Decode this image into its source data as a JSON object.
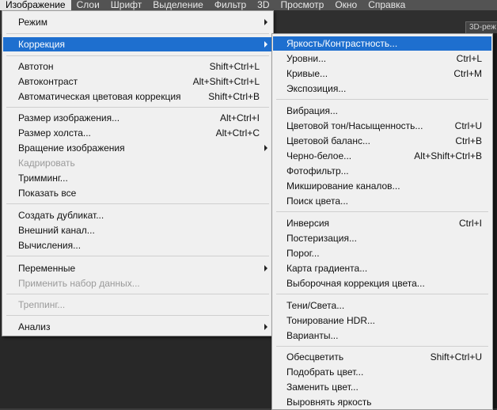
{
  "menubar": {
    "items": [
      {
        "label": "Изображение"
      },
      {
        "label": "Слои"
      },
      {
        "label": "Шрифт"
      },
      {
        "label": "Выделение"
      },
      {
        "label": "Фильтр"
      },
      {
        "label": "3D"
      },
      {
        "label": "Просмотр"
      },
      {
        "label": "Окно"
      },
      {
        "label": "Справка"
      }
    ],
    "workspace_button": "3D-реж"
  },
  "image_menu": {
    "items": [
      {
        "label": "Режим",
        "shortcut": ""
      },
      {
        "label": "Коррекция",
        "shortcut": ""
      },
      {
        "label": "Автотон",
        "shortcut": "Shift+Ctrl+L"
      },
      {
        "label": "Автоконтраст",
        "shortcut": "Alt+Shift+Ctrl+L"
      },
      {
        "label": "Автоматическая цветовая коррекция",
        "shortcut": "Shift+Ctrl+B"
      },
      {
        "label": "Размер изображения...",
        "shortcut": "Alt+Ctrl+I"
      },
      {
        "label": "Размер холста...",
        "shortcut": "Alt+Ctrl+C"
      },
      {
        "label": "Вращение изображения",
        "shortcut": ""
      },
      {
        "label": "Кадрировать",
        "shortcut": ""
      },
      {
        "label": "Тримминг...",
        "shortcut": ""
      },
      {
        "label": "Показать все",
        "shortcut": ""
      },
      {
        "label": "Создать дубликат...",
        "shortcut": ""
      },
      {
        "label": "Внешний канал...",
        "shortcut": ""
      },
      {
        "label": "Вычисления...",
        "shortcut": ""
      },
      {
        "label": "Переменные",
        "shortcut": ""
      },
      {
        "label": "Применить набор данных...",
        "shortcut": ""
      },
      {
        "label": "Треппинг...",
        "shortcut": ""
      },
      {
        "label": "Анализ",
        "shortcut": ""
      }
    ]
  },
  "adjustments_menu": {
    "items": [
      {
        "label": "Яркость/Контрастность...",
        "shortcut": ""
      },
      {
        "label": "Уровни...",
        "shortcut": "Ctrl+L"
      },
      {
        "label": "Кривые...",
        "shortcut": "Ctrl+M"
      },
      {
        "label": "Экспозиция...",
        "shortcut": ""
      },
      {
        "label": "Вибрация...",
        "shortcut": ""
      },
      {
        "label": "Цветовой тон/Насыщенность...",
        "shortcut": "Ctrl+U"
      },
      {
        "label": "Цветовой баланс...",
        "shortcut": "Ctrl+B"
      },
      {
        "label": "Черно-белое...",
        "shortcut": "Alt+Shift+Ctrl+B"
      },
      {
        "label": "Фотофильтр...",
        "shortcut": ""
      },
      {
        "label": "Микширование каналов...",
        "shortcut": ""
      },
      {
        "label": "Поиск цвета...",
        "shortcut": ""
      },
      {
        "label": "Инверсия",
        "shortcut": "Ctrl+I"
      },
      {
        "label": "Постеризация...",
        "shortcut": ""
      },
      {
        "label": "Порог...",
        "shortcut": ""
      },
      {
        "label": "Карта градиента...",
        "shortcut": ""
      },
      {
        "label": "Выборочная коррекция цвета...",
        "shortcut": ""
      },
      {
        "label": "Тени/Света...",
        "shortcut": ""
      },
      {
        "label": "Тонирование HDR...",
        "shortcut": ""
      },
      {
        "label": "Варианты...",
        "shortcut": ""
      },
      {
        "label": "Обесцветить",
        "shortcut": "Shift+Ctrl+U"
      },
      {
        "label": "Подобрать цвет...",
        "shortcut": ""
      },
      {
        "label": "Заменить цвет...",
        "shortcut": ""
      },
      {
        "label": "Выровнять яркость",
        "shortcut": ""
      }
    ]
  },
  "colors": {
    "highlight": "#1e6fcf",
    "menu_bg": "#f0f0f0",
    "disabled": "#9a9a9a"
  }
}
